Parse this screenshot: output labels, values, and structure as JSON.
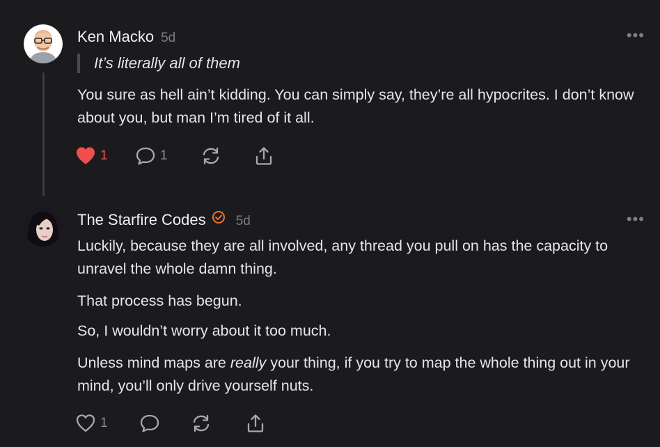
{
  "comments": [
    {
      "author": "Ken Macko",
      "time": "5d",
      "quote": "It’s literally all of them",
      "paragraphs": [
        "You sure as hell ain’t kidding. You can simply say, they’re all hypocrites. I don’t know about you, but man I’m tired of it all."
      ],
      "like_count": "1",
      "liked": true,
      "reply_count": "1",
      "more_label": "•••"
    },
    {
      "author": "The Starfire Codes",
      "verified": true,
      "time": "5d",
      "paragraphs": [
        "Luckily, because they are all involved, any thread you pull on has the capacity to unravel the whole damn thing.",
        "That process has begun.",
        "So, I wouldn’t worry about it too much."
      ],
      "p4_before": "Unless mind maps are ",
      "p4_em": "really",
      "p4_after": " your thing, if you try to map the whole thing out in your mind, you’ll only drive yourself nuts.",
      "like_count": "1",
      "liked": false,
      "more_label": "•••"
    }
  ],
  "icons": {
    "like": "heart-icon",
    "reply": "comment-bubble-icon",
    "restack": "restack-icon",
    "share": "share-icon",
    "verified": "verified-check-icon",
    "more": "more-dots-icon"
  },
  "colors": {
    "background": "#1b1b1d",
    "liked_heart": "#f04f4f",
    "verified_badge": "#f0742c",
    "muted": "#7d7d82"
  }
}
